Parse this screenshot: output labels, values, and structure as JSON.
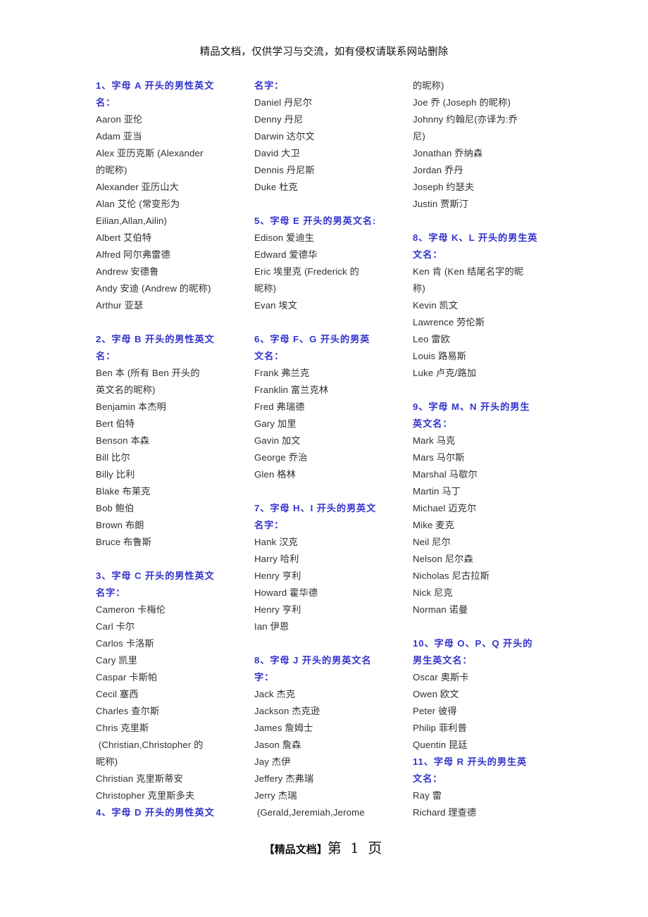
{
  "document": {
    "header_notice": "精品文档，仅供学习与交流，如有侵权请联系网站删除",
    "footer_label": "【精品文档】",
    "footer_page": "第 1 页"
  },
  "columns": [
    {
      "id": "column-1",
      "lines": [
        {
          "type": "heading",
          "text": "1、字母 A 开头的男性英文"
        },
        {
          "type": "heading",
          "text": "名："
        },
        {
          "type": "body",
          "text": "Aaron 亚伦"
        },
        {
          "type": "body",
          "text": "Adam 亚当"
        },
        {
          "type": "body",
          "text": "Alex 亚历克斯 (Alexander"
        },
        {
          "type": "body",
          "text": "的昵称)"
        },
        {
          "type": "body",
          "text": "Alexander 亚历山大"
        },
        {
          "type": "body",
          "text": "Alan 艾伦 (常变形为"
        },
        {
          "type": "body",
          "text": "Eilian,Allan,Ailin)"
        },
        {
          "type": "body",
          "text": "Albert 艾伯特"
        },
        {
          "type": "body",
          "text": "Alfred 阿尔弗雷德"
        },
        {
          "type": "body",
          "text": "Andrew 安德鲁"
        },
        {
          "type": "body",
          "text": "Andy 安迪 (Andrew 的昵称)"
        },
        {
          "type": "body",
          "text": "Arthur 亚瑟"
        },
        {
          "type": "blank",
          "text": " "
        },
        {
          "type": "heading",
          "text": "2、字母 B 开头的男性英文"
        },
        {
          "type": "heading",
          "text": "名："
        },
        {
          "type": "body",
          "text": "Ben 本 (所有 Ben 开头的"
        },
        {
          "type": "body",
          "text": "英文名的昵称)"
        },
        {
          "type": "body",
          "text": "Benjamin 本杰明"
        },
        {
          "type": "body",
          "text": "Bert 伯特"
        },
        {
          "type": "body",
          "text": "Benson 本森"
        },
        {
          "type": "body",
          "text": "Bill 比尔"
        },
        {
          "type": "body",
          "text": "Billy 比利"
        },
        {
          "type": "body",
          "text": "Blake 布莱克"
        },
        {
          "type": "body",
          "text": "Bob 鲍伯"
        },
        {
          "type": "body",
          "text": "Brown 布朗"
        },
        {
          "type": "body",
          "text": "Bruce 布鲁斯"
        },
        {
          "type": "blank",
          "text": " "
        },
        {
          "type": "heading",
          "text": "3、字母 C 开头的男性英文"
        },
        {
          "type": "heading",
          "text": "名字："
        },
        {
          "type": "body",
          "text": "Cameron 卡梅伦"
        },
        {
          "type": "body",
          "text": "Carl 卡尔"
        },
        {
          "type": "body",
          "text": "Carlos 卡洛斯"
        },
        {
          "type": "body",
          "text": "Cary 凯里"
        },
        {
          "type": "body",
          "text": "Caspar 卡斯帕"
        },
        {
          "type": "body",
          "text": "Cecil 塞西"
        },
        {
          "type": "body",
          "text": "Charles 查尔斯"
        },
        {
          "type": "body",
          "text": "Chris 克里斯"
        },
        {
          "type": "body",
          "text": " (Christian,Christopher 的"
        },
        {
          "type": "body",
          "text": "昵称)"
        },
        {
          "type": "body",
          "text": "Christian 克里斯蒂安"
        },
        {
          "type": "body",
          "text": "Christopher 克里斯多夫"
        },
        {
          "type": "heading",
          "text": "4、字母 D 开头的男性英文"
        }
      ]
    },
    {
      "id": "column-2",
      "lines": [
        {
          "type": "heading",
          "text": "名字："
        },
        {
          "type": "body",
          "text": "Daniel 丹尼尔"
        },
        {
          "type": "body",
          "text": "Denny 丹尼"
        },
        {
          "type": "body",
          "text": "Darwin 达尔文"
        },
        {
          "type": "body",
          "text": "David 大卫"
        },
        {
          "type": "body",
          "text": "Dennis 丹尼斯"
        },
        {
          "type": "body",
          "text": "Duke 杜克"
        },
        {
          "type": "blank",
          "text": " "
        },
        {
          "type": "heading",
          "text": "5、字母 E 开头的男英文名:"
        },
        {
          "type": "body",
          "text": "Edison 爱迪生"
        },
        {
          "type": "body",
          "text": "Edward 爱德华"
        },
        {
          "type": "body",
          "text": "Eric 埃里克 (Frederick 的"
        },
        {
          "type": "body",
          "text": "昵称)"
        },
        {
          "type": "body",
          "text": "Evan 埃文"
        },
        {
          "type": "blank",
          "text": " "
        },
        {
          "type": "heading",
          "text": "6、字母 F、G 开头的男英"
        },
        {
          "type": "heading",
          "text": "文名："
        },
        {
          "type": "body",
          "text": "Frank 弗兰克"
        },
        {
          "type": "body",
          "text": "Franklin 富兰克林"
        },
        {
          "type": "body",
          "text": "Fred 弗瑞德"
        },
        {
          "type": "body",
          "text": "Gary 加里"
        },
        {
          "type": "body",
          "text": "Gavin 加文"
        },
        {
          "type": "body",
          "text": "George 乔治"
        },
        {
          "type": "body",
          "text": "Glen 格林"
        },
        {
          "type": "blank",
          "text": " "
        },
        {
          "type": "heading",
          "text": "7、字母 H、I 开头的男英文"
        },
        {
          "type": "heading",
          "text": "名字："
        },
        {
          "type": "body",
          "text": "Hank 汉克"
        },
        {
          "type": "body",
          "text": "Harry 哈利"
        },
        {
          "type": "body",
          "text": "Henry 亨利"
        },
        {
          "type": "body",
          "text": "Howard 霍华德"
        },
        {
          "type": "body",
          "text": "Henry 亨利"
        },
        {
          "type": "body",
          "text": "Ian 伊恩"
        },
        {
          "type": "blank",
          "text": " "
        },
        {
          "type": "heading",
          "text": "8、字母 J 开头的男英文名"
        },
        {
          "type": "heading",
          "text": "字："
        },
        {
          "type": "body",
          "text": "Jack 杰克"
        },
        {
          "type": "body",
          "text": "Jackson 杰克逊"
        },
        {
          "type": "body",
          "text": "James 詹姆士"
        },
        {
          "type": "body",
          "text": "Jason 詹森"
        },
        {
          "type": "body",
          "text": "Jay 杰伊"
        },
        {
          "type": "body",
          "text": "Jeffery 杰弗瑞"
        },
        {
          "type": "body",
          "text": "Jerry 杰瑞"
        },
        {
          "type": "body",
          "text": " (Gerald,Jeremiah,Jerome"
        }
      ]
    },
    {
      "id": "column-3",
      "lines": [
        {
          "type": "body",
          "text": "的昵称)"
        },
        {
          "type": "body",
          "text": "Joe 乔 (Joseph 的昵称)"
        },
        {
          "type": "body",
          "text": "Johnny 约翰尼(亦译为:乔"
        },
        {
          "type": "body",
          "text": "尼)"
        },
        {
          "type": "body",
          "text": "Jonathan 乔纳森"
        },
        {
          "type": "body",
          "text": "Jordan 乔丹"
        },
        {
          "type": "body",
          "text": "Joseph 约瑟夫"
        },
        {
          "type": "body",
          "text": "Justin 贾斯汀"
        },
        {
          "type": "blank",
          "text": " "
        },
        {
          "type": "heading",
          "text": "8、字母 K、L 开头的男生英"
        },
        {
          "type": "heading",
          "text": "文名："
        },
        {
          "type": "body",
          "text": "Ken 肯 (Ken 结尾名字的昵"
        },
        {
          "type": "body",
          "text": "称)"
        },
        {
          "type": "body",
          "text": "Kevin 凯文"
        },
        {
          "type": "body",
          "text": "Lawrence 劳伦斯"
        },
        {
          "type": "body",
          "text": "Leo 雷欧"
        },
        {
          "type": "body",
          "text": "Louis 路易斯"
        },
        {
          "type": "body",
          "text": "Luke 卢克/路加"
        },
        {
          "type": "blank",
          "text": " "
        },
        {
          "type": "heading",
          "text": "9、字母 M、N 开头的男生"
        },
        {
          "type": "heading",
          "text": "英文名："
        },
        {
          "type": "body",
          "text": "Mark 马克"
        },
        {
          "type": "body",
          "text": "Mars 马尔斯"
        },
        {
          "type": "body",
          "text": "Marshal 马歇尔"
        },
        {
          "type": "body",
          "text": "Martin 马丁"
        },
        {
          "type": "body",
          "text": "Michael 迈克尔"
        },
        {
          "type": "body",
          "text": "Mike 麦克"
        },
        {
          "type": "body",
          "text": "Neil 尼尔"
        },
        {
          "type": "body",
          "text": "Nelson 尼尔森"
        },
        {
          "type": "body",
          "text": "Nicholas 尼古拉斯"
        },
        {
          "type": "body",
          "text": "Nick 尼克"
        },
        {
          "type": "body",
          "text": "Norman 诺曼"
        },
        {
          "type": "blank",
          "text": " "
        },
        {
          "type": "heading",
          "text": "10、字母 O、P、Q 开头的"
        },
        {
          "type": "heading",
          "text": "男生英文名："
        },
        {
          "type": "body",
          "text": "Oscar 奥斯卡"
        },
        {
          "type": "body",
          "text": "Owen 欧文"
        },
        {
          "type": "body",
          "text": "Peter 彼得"
        },
        {
          "type": "body",
          "text": "Philip 菲利普"
        },
        {
          "type": "body",
          "text": "Quentin 昆廷"
        },
        {
          "type": "heading",
          "text": "11、字母 R 开头的男生英"
        },
        {
          "type": "heading",
          "text": "文名："
        },
        {
          "type": "body",
          "text": "Ray 雷"
        },
        {
          "type": "body",
          "text": "Richard 理查德"
        }
      ]
    }
  ],
  "colors": {
    "heading": "#3333cc",
    "body": "#2f2f2f",
    "page_background": "#ffffff"
  }
}
